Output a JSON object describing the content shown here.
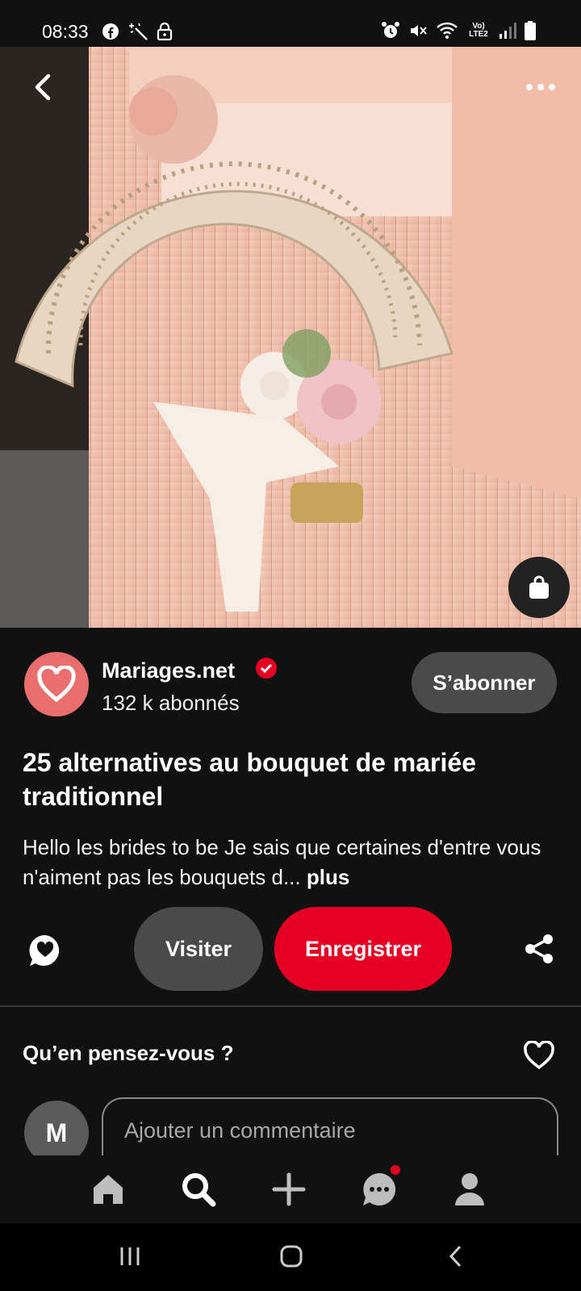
{
  "status_bar": {
    "time": "08:33",
    "network_label": "Vo) LTE2",
    "left_icons": [
      "facebook-icon",
      "magic-wand-icon",
      "lock-icon"
    ],
    "right_icons": [
      "alarm-icon",
      "mute-icon",
      "wifi-icon",
      "signal-icon",
      "battery-icon"
    ]
  },
  "pin": {
    "image_description_icons": [
      "back-icon",
      "more-icon",
      "lens-icon"
    ],
    "creator_name": "Mariages.net",
    "followers": "132 k abonnés",
    "follow_label": "S’abonner",
    "title": "25 alternatives au bouquet de mariée traditionnel",
    "description": "Hello les brides to be Je sais que certaines d'entre vous n'aiment pas les bouquets d...",
    "more_label": "plus"
  },
  "actions": {
    "visit_label": "Visiter",
    "save_label": "Enregistrer"
  },
  "comments": {
    "question": "Qu’en pensez-vous ?",
    "user_initial": "M",
    "placeholder": "Ajouter un commentaire"
  },
  "tabbar": {
    "items": [
      "home-icon",
      "search-icon",
      "create-icon",
      "messages-icon",
      "profile-icon"
    ]
  },
  "colors": {
    "background": "#111111",
    "brand_red": "#e60023",
    "button_gray": "#4a4a4a",
    "creator_avatar": "#ea6e6e"
  }
}
